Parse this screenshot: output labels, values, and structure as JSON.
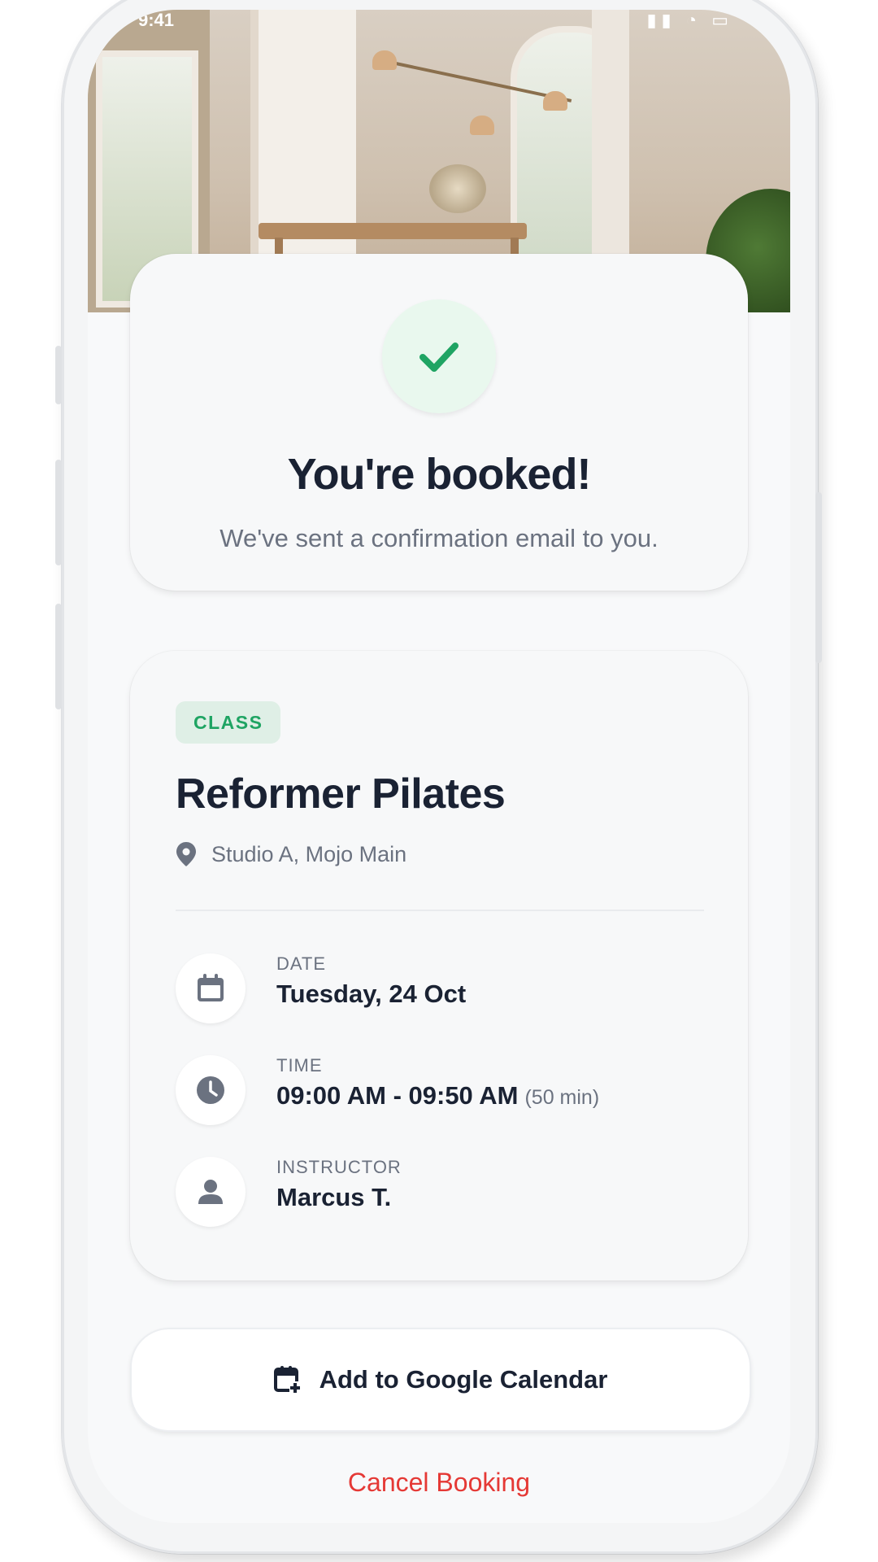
{
  "status_bar": {
    "time": "9:41",
    "icons": [
      "signal-icon",
      "wifi-icon",
      "battery-icon"
    ]
  },
  "confirmation": {
    "title": "You're booked!",
    "subtitle": "We've sent a confirmation email to you.",
    "icon": "check-icon"
  },
  "booking": {
    "badge": "CLASS",
    "title": "Reformer Pilates",
    "location": "Studio A, Mojo Main",
    "details": [
      {
        "label": "DATE",
        "value": "Tuesday, 24 Oct",
        "icon": "calendar-icon"
      },
      {
        "label": "TIME",
        "value": "09:00 AM - 09:50 AM",
        "extra": "(50 min)",
        "icon": "clock-icon"
      },
      {
        "label": "INSTRUCTOR",
        "value": "Marcus T.",
        "icon": "person-icon"
      }
    ]
  },
  "actions": {
    "add_calendar": "Add to Google Calendar",
    "cancel": "Cancel Booking"
  },
  "colors": {
    "accent_green": "#1fa463",
    "danger_red": "#e53935",
    "text_dark": "#1a2233",
    "text_muted": "#6b7280"
  }
}
